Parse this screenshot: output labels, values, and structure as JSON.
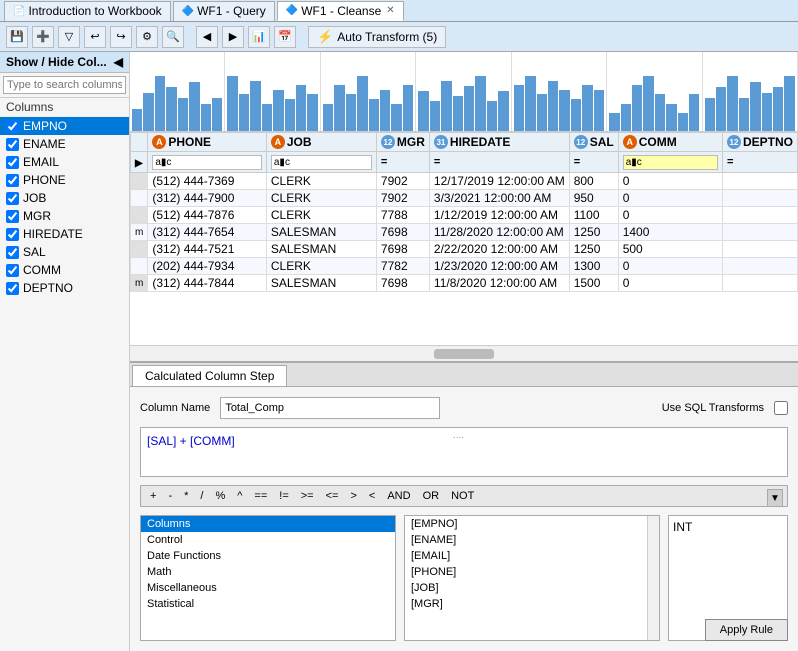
{
  "tabs": [
    {
      "label": "Introduction to Workbook",
      "active": false,
      "icon": "📄"
    },
    {
      "label": "WF1 - Query",
      "active": false,
      "icon": "🔷"
    },
    {
      "label": "WF1 - Cleanse",
      "active": true,
      "icon": "🔷"
    }
  ],
  "toolbar": {
    "auto_transform_label": "Auto Transform (5)"
  },
  "sidebar": {
    "header": "Show / Hide Col...",
    "search_placeholder": "Type to search columns",
    "columns_label": "Columns",
    "items": [
      {
        "label": "EMPNO",
        "checked": true,
        "selected": true
      },
      {
        "label": "ENAME",
        "checked": true,
        "selected": false
      },
      {
        "label": "EMAIL",
        "checked": true,
        "selected": false
      },
      {
        "label": "PHONE",
        "checked": true,
        "selected": false
      },
      {
        "label": "JOB",
        "checked": true,
        "selected": false
      },
      {
        "label": "MGR",
        "checked": true,
        "selected": false
      },
      {
        "label": "HIREDATE",
        "checked": true,
        "selected": false
      },
      {
        "label": "SAL",
        "checked": true,
        "selected": false
      },
      {
        "label": "COMM",
        "checked": true,
        "selected": false
      },
      {
        "label": "DEPTNO",
        "checked": true,
        "selected": false
      }
    ]
  },
  "table": {
    "columns": [
      {
        "name": "PHONE",
        "badge": "A",
        "badge_type": "a"
      },
      {
        "name": "JOB",
        "badge": "A",
        "badge_type": "a"
      },
      {
        "name": "MGR",
        "badge": "12",
        "badge_type": "12"
      },
      {
        "name": "HIREDATE",
        "badge": "31",
        "badge_type": "31"
      },
      {
        "name": "SAL",
        "badge": "12",
        "badge_type": "12"
      },
      {
        "name": "COMM",
        "badge": "A",
        "badge_type": "a"
      },
      {
        "name": "DEPTNO",
        "badge": "12",
        "badge_type": "12"
      }
    ],
    "rows": [
      {
        "marker": "",
        "phone": "(512) 444-7369",
        "job": "CLERK",
        "mgr": "7902",
        "hiredate": "12/17/2019 12:00:00 AM",
        "sal": "800",
        "comm": "0",
        "deptno": ""
      },
      {
        "marker": "",
        "phone": "(312) 444-7900",
        "job": "CLERK",
        "mgr": "7902",
        "hiredate": "3/3/2021 12:00:00 AM",
        "sal": "950",
        "comm": "0",
        "deptno": ""
      },
      {
        "marker": "",
        "phone": "(512) 444-7876",
        "job": "CLERK",
        "mgr": "7788",
        "hiredate": "1/12/2019 12:00:00 AM",
        "sal": "1100",
        "comm": "0",
        "deptno": ""
      },
      {
        "marker": "m",
        "phone": "(312) 444-7654",
        "job": "SALESMAN",
        "mgr": "7698",
        "hiredate": "11/28/2020 12:00:00 AM",
        "sal": "1250",
        "comm": "1400",
        "deptno": ""
      },
      {
        "marker": "",
        "phone": "(312) 444-7521",
        "job": "SALESMAN",
        "mgr": "7698",
        "hiredate": "2/22/2020 12:00:00 AM",
        "sal": "1250",
        "comm": "500",
        "deptno": ""
      },
      {
        "marker": "",
        "phone": "(202) 444-7934",
        "job": "CLERK",
        "mgr": "7782",
        "hiredate": "1/23/2020 12:00:00 AM",
        "sal": "1300",
        "comm": "0",
        "deptno": ""
      },
      {
        "marker": "m",
        "phone": "(312) 444-7844",
        "job": "SALESMAN",
        "mgr": "7698",
        "hiredate": "11/8/2020 12:00:00 AM",
        "sal": "1500",
        "comm": "0",
        "deptno": ""
      }
    ]
  },
  "lower_panel": {
    "tab_label": "Calculated Column Step",
    "column_name_label": "Column Name",
    "column_name_value": "Total_Comp",
    "sql_transforms_label": "Use SQL Transforms",
    "expression": "[SAL]  +  [COMM]",
    "operators": [
      "+",
      "-",
      "*",
      "/",
      "%",
      "^",
      "==",
      "!=",
      ">=",
      "<=",
      ">",
      "<",
      "AND",
      "OR",
      "NOT"
    ],
    "categories": [
      {
        "label": "Columns",
        "selected": true
      },
      {
        "label": "Control",
        "selected": false
      },
      {
        "label": "Date Functions",
        "selected": false
      },
      {
        "label": "Math",
        "selected": false
      },
      {
        "label": "Miscellaneous",
        "selected": false
      },
      {
        "label": "Statistical",
        "selected": false
      }
    ],
    "columns_list": [
      {
        "label": "[EMPNO]",
        "selected": false
      },
      {
        "label": "[ENAME]",
        "selected": false
      },
      {
        "label": "[EMAIL]",
        "selected": false
      },
      {
        "label": "[PHONE]",
        "selected": false
      },
      {
        "label": "[JOB]",
        "selected": false
      },
      {
        "label": "[MGR]",
        "selected": false
      }
    ],
    "type_value": "INT",
    "apply_rule_label": "Apply Rule"
  },
  "charts": {
    "phone": [
      20,
      35,
      50,
      40,
      30,
      45,
      25,
      30
    ],
    "job": [
      60,
      40,
      55,
      30,
      45,
      35,
      50,
      40
    ],
    "mgr": [
      30,
      50,
      40,
      60,
      35,
      45,
      30,
      50
    ],
    "hiredate": [
      40,
      30,
      50,
      35,
      45,
      55,
      30,
      40
    ],
    "sal": [
      50,
      60,
      40,
      55,
      45,
      35,
      50,
      45
    ],
    "comm": [
      20,
      30,
      50,
      60,
      40,
      30,
      20,
      40
    ],
    "deptno": [
      30,
      40,
      50,
      30,
      45,
      35,
      40,
      50
    ]
  }
}
